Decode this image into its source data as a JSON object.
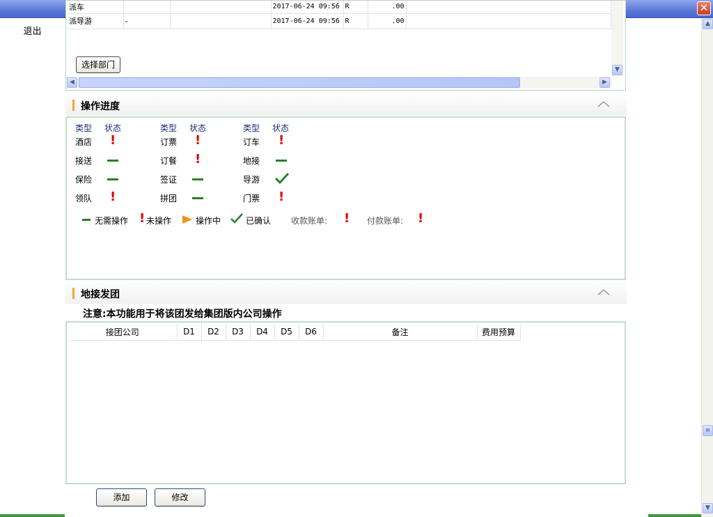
{
  "window": {
    "close_label": "✕"
  },
  "nav": {
    "exit_label": "退出"
  },
  "top_table": {
    "rows": [
      {
        "type": "派车",
        "c1": "",
        "c2": "",
        "time": "2017-06-24 09:56",
        "flag": "R",
        "amount": ".00"
      },
      {
        "type": "派导游",
        "c1": "-",
        "c2": "",
        "time": "2017-06-24 09:56",
        "flag": "R",
        "amount": ".00"
      }
    ],
    "select_dept_button": "选择部门"
  },
  "progress": {
    "title": "操作进度",
    "col_type": "类型",
    "col_status": "状态",
    "items": [
      {
        "label": "酒店",
        "status": "not-done"
      },
      {
        "label": "接送",
        "status": "none"
      },
      {
        "label": "保险",
        "status": "none"
      },
      {
        "label": "领队",
        "status": "not-done"
      },
      {
        "label": "订票",
        "status": "not-done"
      },
      {
        "label": "订餐",
        "status": "not-done"
      },
      {
        "label": "签证",
        "status": "none"
      },
      {
        "label": "拼团",
        "status": "none"
      },
      {
        "label": "订车",
        "status": "not-done"
      },
      {
        "label": "地接",
        "status": "none"
      },
      {
        "label": "导游",
        "status": "confirmed"
      },
      {
        "label": "门票",
        "status": "not-done"
      }
    ],
    "legend": {
      "none": "无需操作",
      "not_done": "未操作",
      "in_progress": "操作中",
      "confirmed": "已确认",
      "receivable": "收款账单:",
      "payable": "付款账单:"
    },
    "colors": {
      "none": "#2a7f2a",
      "not_done": "#e30000",
      "in_progress": "#f5901e",
      "confirmed": "#2a7f2a"
    }
  },
  "dispatch": {
    "title": "地接发团",
    "notice": "注意:本功能用于将该团发给集团版内公司操作",
    "columns": [
      "接团公司",
      "D1",
      "D2",
      "D3",
      "D4",
      "D5",
      "D6",
      "备注",
      "费用预算"
    ],
    "add_button": "添加",
    "edit_button": "修改"
  }
}
